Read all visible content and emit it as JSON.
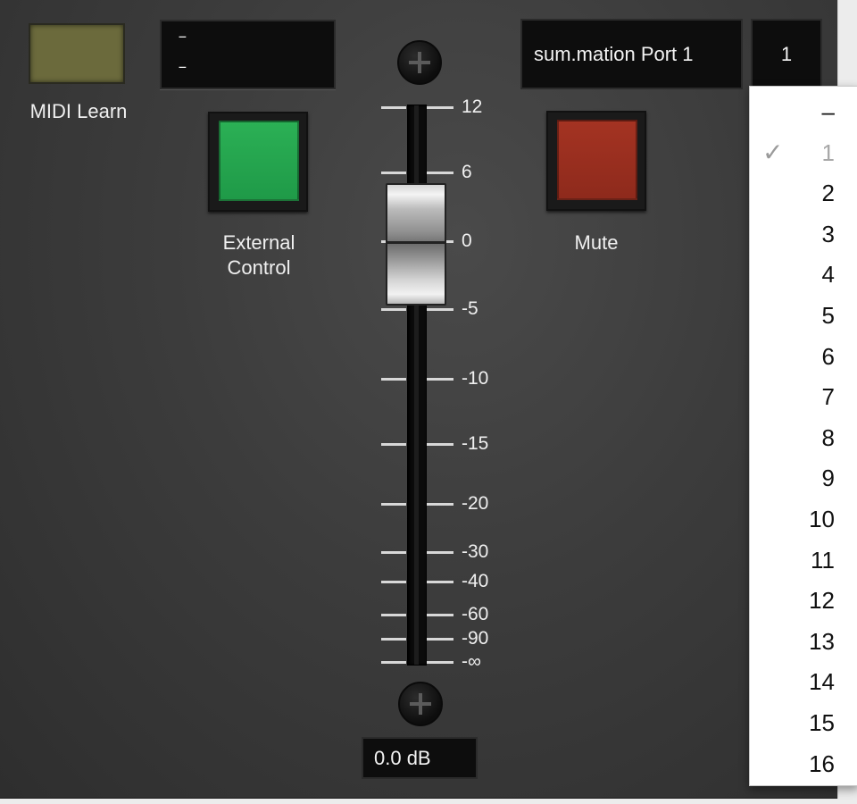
{
  "midi": {
    "label": "MIDI Learn"
  },
  "name_display": {
    "line1": "–",
    "line2": "–"
  },
  "external_control": {
    "label_line1": "External",
    "label_line2": "Control"
  },
  "mute": {
    "label": "Mute"
  },
  "fader": {
    "scale": [
      "12",
      "6",
      "0",
      "-5",
      "-10",
      "-15",
      "-20",
      "-30",
      "-40",
      "-60",
      "-90",
      "-∞"
    ],
    "value_db": 0.0,
    "readout": "0.0 dB"
  },
  "port": {
    "name": "sum.mation Port 1",
    "channel": "1"
  },
  "channel_menu": {
    "items": [
      "–",
      "1",
      "2",
      "3",
      "4",
      "5",
      "6",
      "7",
      "8",
      "9",
      "10",
      "11",
      "12",
      "13",
      "14",
      "15",
      "16"
    ],
    "selected": "1",
    "check_glyph": "✓"
  },
  "colors": {
    "external_control_green": "#2bb055",
    "mute_red": "#a43322",
    "midi_led_olive": "#6b6a3c",
    "panel_gray": "#3c3c3c"
  }
}
